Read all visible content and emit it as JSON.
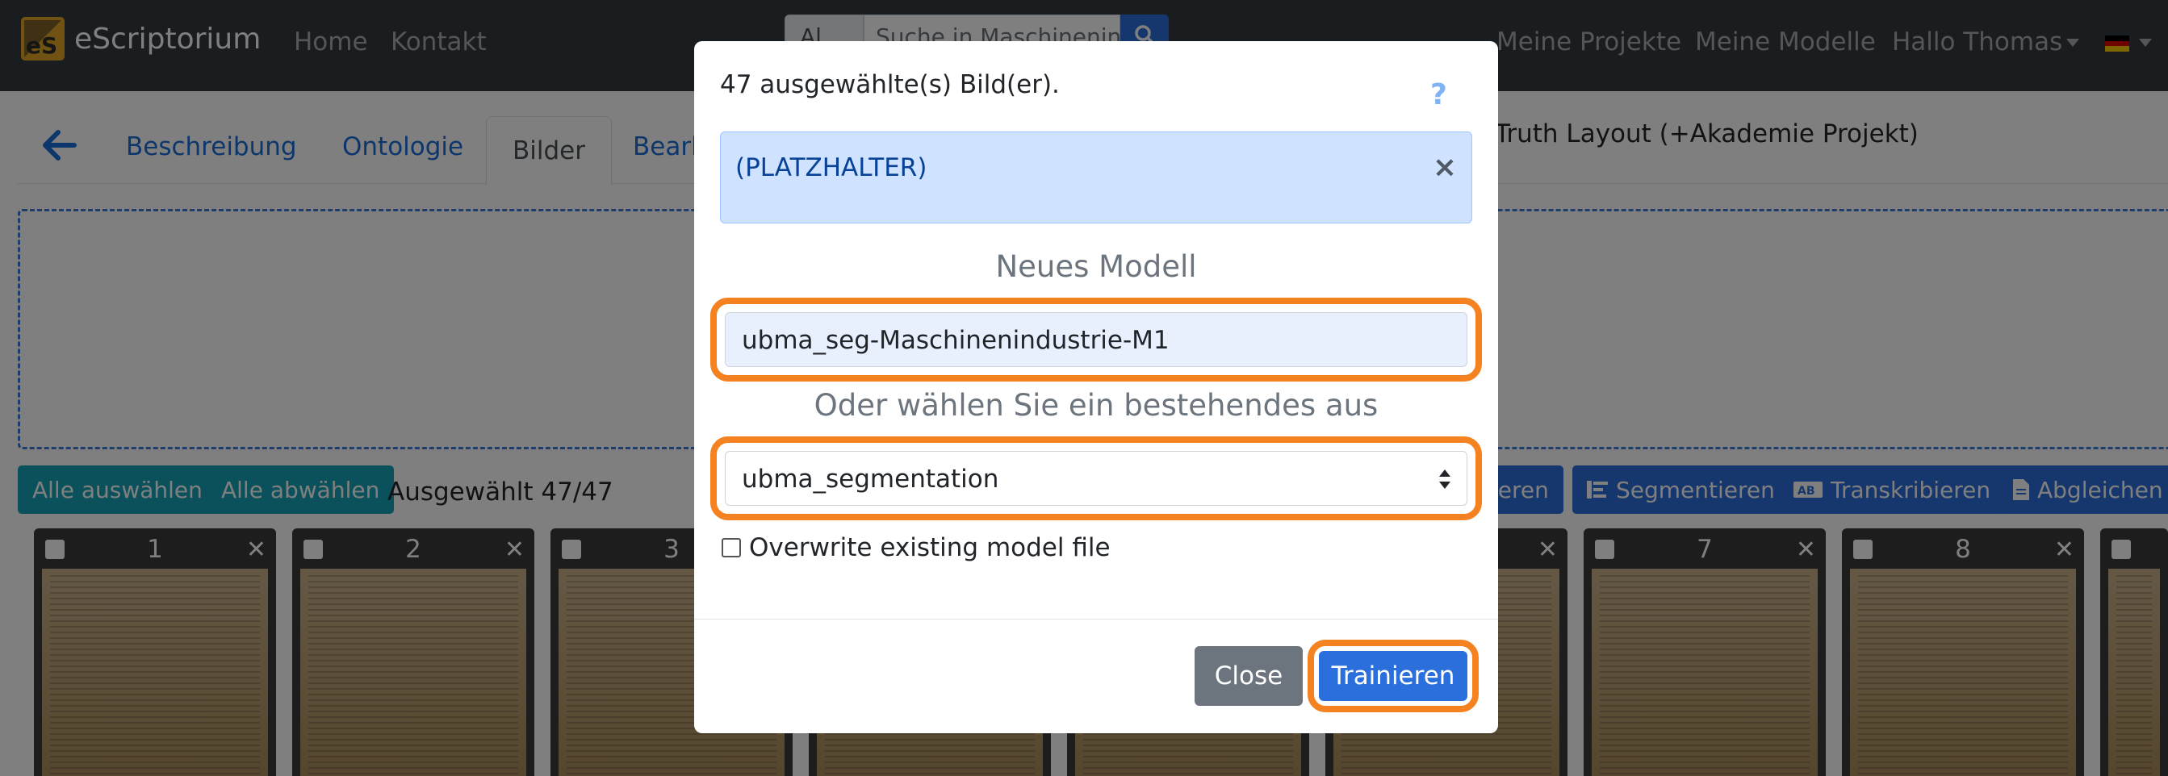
{
  "navbar": {
    "brand": "eScriptorium",
    "logo_text": "eS",
    "links": [
      "Home",
      "Kontakt"
    ],
    "search": {
      "scope": "Al",
      "placeholder": "Suche in Maschinenindu"
    },
    "right_links": [
      "Meine Projekte",
      "Meine Modelle",
      "Hallo Thomas"
    ],
    "icons": [
      "search-icon",
      "caret-down-icon",
      "german-flag-icon"
    ]
  },
  "tabs": [
    "Beschreibung",
    "Ontologie",
    "Bilder",
    "Bearb"
  ],
  "active_tab": "Bilder",
  "document_title": "Truth Layout (+Akademie Projekt)",
  "toolbar": {
    "select_all": "Alle auswählen",
    "deselect_all": "Alle abwählen",
    "selected_count": "Ausgewählt 47/47",
    "actions": [
      {
        "label": "ieren",
        "icon": ""
      },
      {
        "label": "Segmentieren",
        "icon": "align-left-icon"
      },
      {
        "label": "Transkribieren",
        "icon": "ab-icon"
      },
      {
        "label": "Abgleichen",
        "icon": "file-icon"
      }
    ]
  },
  "thumbnails": [
    "1",
    "2",
    "3",
    "",
    "",
    "",
    "7",
    "8",
    ""
  ],
  "modal": {
    "header": "47 ausgewählte(s) Bild(er).",
    "help": "?",
    "alert_text": "(PLATZHALTER)",
    "alert_close": "×",
    "new_model_label": "Neues Modell",
    "new_model_value": "ubma_seg-Maschinenindustrie-M1",
    "existing_label": "Oder wählen Sie ein bestehendes aus",
    "existing_value": "ubma_segmentation",
    "overwrite_label": "Overwrite existing model file",
    "overwrite_checked": false,
    "close_label": "Close",
    "train_label": "Trainieren"
  },
  "colors": {
    "navbar": "#343a40",
    "primary": "#2a6fdb",
    "teal": "#17a2b8",
    "highlight": "#f58220",
    "alert_bg": "#cfe2ff"
  }
}
